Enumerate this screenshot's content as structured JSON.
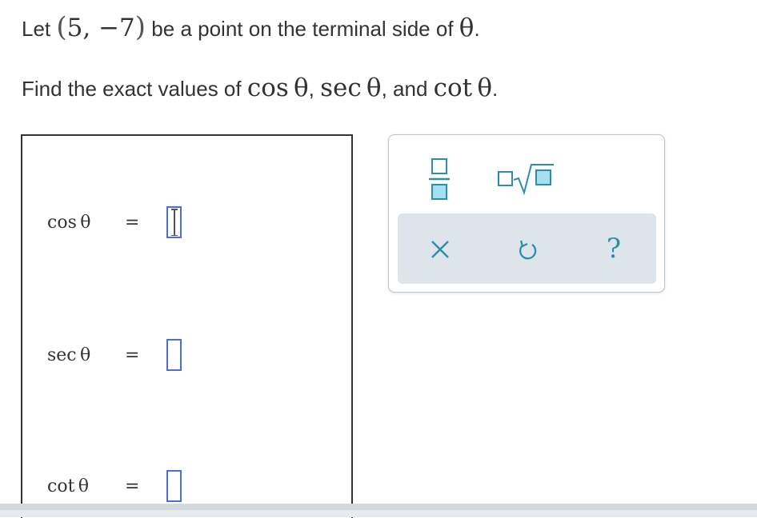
{
  "question": {
    "line1": {
      "prefix": "Let",
      "point_open": "(",
      "point_coords": "5, −7",
      "point_close": ")",
      "middle": "be a point on the terminal side of",
      "theta": "θ",
      "end": "."
    },
    "line2": {
      "prefix": "Find the exact values of",
      "f1": "cos θ",
      "sep1": ",",
      "f2": "sec θ",
      "sep2": ", and",
      "f3": "cot θ",
      "end": "."
    }
  },
  "answers": {
    "rows": [
      {
        "label": "cos θ",
        "sign": "=",
        "value": "",
        "active": true
      },
      {
        "label": "sec θ",
        "sign": "=",
        "value": "",
        "active": false
      },
      {
        "label": "cot θ",
        "sign": "=",
        "value": "",
        "active": false
      }
    ]
  },
  "toolbar": {
    "tools": [
      "fraction-icon",
      "sqrt-icon"
    ],
    "actions": [
      "clear-icon",
      "undo-icon",
      "help-icon"
    ],
    "help_label": "?",
    "colors": {
      "accent": "#2c8fa8",
      "fill": "#a6dff0",
      "panel": "#dde5ea",
      "input_border": "#4a6fd0"
    }
  }
}
